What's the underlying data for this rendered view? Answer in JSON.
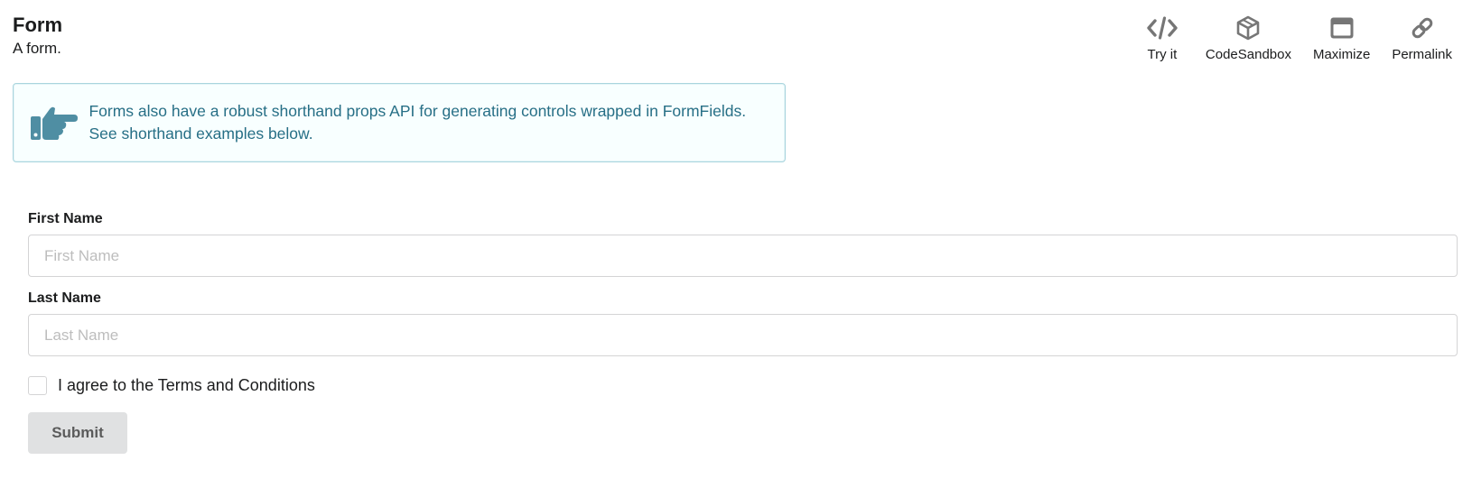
{
  "header": {
    "title": "Form",
    "subtitle": "A form."
  },
  "toolbar": {
    "items": [
      {
        "label": "Try it",
        "icon": "code-icon"
      },
      {
        "label": "CodeSandbox",
        "icon": "cube-icon"
      },
      {
        "label": "Maximize",
        "icon": "window-maximize-icon"
      },
      {
        "label": "Permalink",
        "icon": "link-icon"
      }
    ]
  },
  "message": {
    "icon": "hand-point-right-icon",
    "text": "Forms also have a robust shorthand props API for generating controls wrapped in FormFields. See shorthand examples below."
  },
  "form": {
    "first_name": {
      "label": "First Name",
      "placeholder": "First Name",
      "value": ""
    },
    "last_name": {
      "label": "Last Name",
      "placeholder": "Last Name",
      "value": ""
    },
    "terms": {
      "label": "I agree to the Terms and Conditions",
      "checked": false
    },
    "submit_label": "Submit"
  },
  "colors": {
    "message_background": "#f8ffff",
    "message_border": "#a9d5de",
    "message_text": "#276f86",
    "button_background": "#e0e1e2",
    "icon_gray": "#767676"
  }
}
